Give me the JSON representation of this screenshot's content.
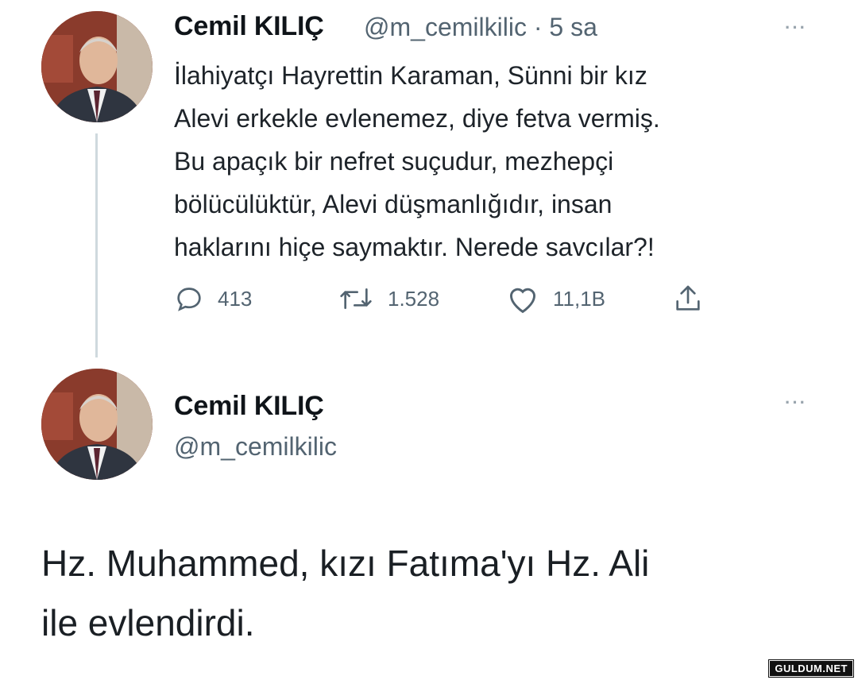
{
  "tweet1": {
    "author_name": "Cemil KILIÇ",
    "handle": "@m_cemilkilic",
    "separator": "·",
    "time": "5 sa",
    "more_label": "···",
    "text": "İlahiyatçı Hayrettin Karaman, Sünni bir kız\nAlevi erkekle evlenemez, diye fetva vermiş.\nBu apaçık bir nefret suçudur, mezhepçi\nbölücülüktür, Alevi düşmanlığıdır, insan\nhaklarını hiçe saymaktır. Nerede savcılar?!",
    "actions": {
      "reply_icon": "reply-icon",
      "reply_count": "413",
      "retweet_icon": "retweet-icon",
      "retweet_count": "1.528",
      "like_icon": "like-icon",
      "like_count": "11,1B",
      "share_icon": "share-icon"
    }
  },
  "tweet2": {
    "author_name": "Cemil KILIÇ",
    "handle": "@m_cemilkilic",
    "more_label": "···",
    "text": "Hz. Muhammed, kızı Fatıma'yı Hz. Ali\nile evlendirdi."
  },
  "watermark": "GULDUM.NET",
  "colors": {
    "text_primary": "#0f1419",
    "text_secondary": "#536471",
    "thread_line": "#cfd9de",
    "avatar_background": "#8a3b2c"
  }
}
